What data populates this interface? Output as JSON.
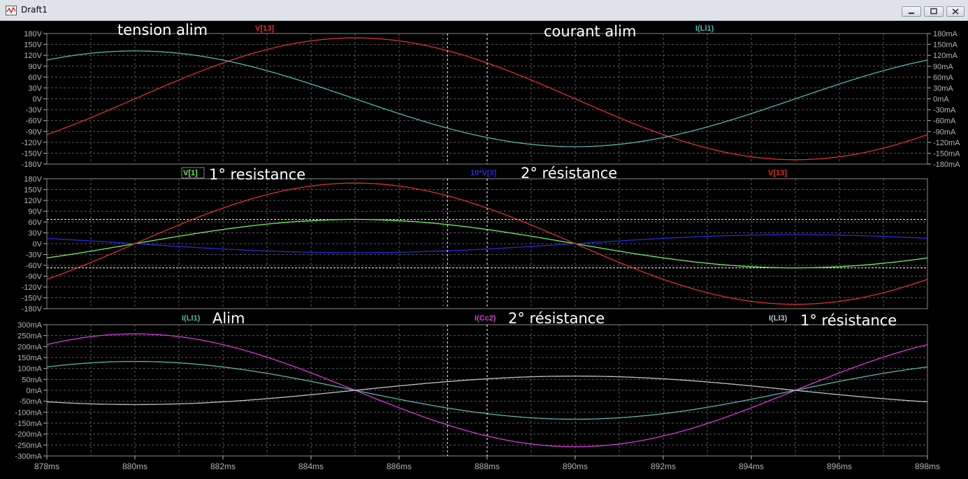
{
  "window": {
    "title": "Draft1"
  },
  "colors": {
    "background": "#000000",
    "grid": "#5a5a5a",
    "axis_text": "#b4b4b4",
    "V13": "#e0302a",
    "IL1": "#4fb7b0",
    "V1": "#6ef05a",
    "V3": "#2a2ad8",
    "ICc2": "#d63ad6",
    "IL3": "#c0c0c0",
    "cursor": "#ffffff"
  },
  "chart_data": [
    {
      "type": "line",
      "pane": 1,
      "xlim": [
        878,
        898
      ],
      "ylim": [
        -180,
        180
      ],
      "y2lim": [
        -180,
        180
      ],
      "grid": true,
      "annotations": [
        "tension alim",
        "courant alim"
      ],
      "left_ticks": [
        "180V",
        "150V",
        "120V",
        "90V",
        "60V",
        "30V",
        "0V",
        "-30V",
        "-60V",
        "-90V",
        "-120V",
        "-150V",
        "-180V"
      ],
      "right_ticks": [
        "180mA",
        "150mA",
        "120mA",
        "90mA",
        "60mA",
        "30mA",
        "0mA",
        "-30mA",
        "-60mA",
        "-90mA",
        "-120mA",
        "-150mA",
        "-180mA"
      ],
      "series": [
        {
          "name": "V[13]",
          "color": "#e0302a",
          "axis": "left",
          "amplitude": 168,
          "frequency_hz": 50,
          "phase_deg": 0
        },
        {
          "name": "I(Ll1)",
          "color": "#4fb7b0",
          "axis": "right",
          "amplitude": 132,
          "frequency_hz": 50,
          "phase_deg": 90
        }
      ]
    },
    {
      "type": "line",
      "pane": 2,
      "xlim": [
        878,
        898
      ],
      "ylim": [
        -180,
        180
      ],
      "grid": true,
      "annotations": [
        "1° resistance",
        "2° résistance"
      ],
      "left_ticks": [
        "180V",
        "150V",
        "120V",
        "90V",
        "60V",
        "30V",
        "0V",
        "-30V",
        "-60V",
        "-90V",
        "-120V",
        "-150V",
        "-180V"
      ],
      "series": [
        {
          "name": "V[1]",
          "color": "#6ef05a",
          "axis": "left",
          "amplitude": 67,
          "frequency_hz": 50,
          "phase_deg": 0
        },
        {
          "name": "10*V[3]",
          "color": "#2a2ad8",
          "axis": "left",
          "amplitude": 25,
          "frequency_hz": 50,
          "phase_deg": 180
        },
        {
          "name": "V[13]",
          "color": "#e0302a",
          "axis": "left",
          "amplitude": 168,
          "frequency_hz": 50,
          "phase_deg": 0
        }
      ],
      "hlines": [
        67,
        -67
      ]
    },
    {
      "type": "line",
      "pane": 3,
      "xlim": [
        878,
        898
      ],
      "ylim": [
        -300,
        300
      ],
      "grid": true,
      "annotations": [
        "Alim",
        "2° résistance",
        "1° résistance"
      ],
      "left_ticks": [
        "300mA",
        "250mA",
        "200mA",
        "150mA",
        "100mA",
        "50mA",
        "0mA",
        "-50mA",
        "-100mA",
        "-150mA",
        "-200mA",
        "-250mA",
        "-300mA"
      ],
      "x_ticks": [
        "878ms",
        "880ms",
        "882ms",
        "884ms",
        "886ms",
        "888ms",
        "890ms",
        "892ms",
        "894ms",
        "896ms",
        "898ms"
      ],
      "series": [
        {
          "name": "I(Ll1)",
          "color": "#4fb7b0",
          "axis": "left",
          "amplitude": 132,
          "frequency_hz": 50,
          "phase_deg": 90
        },
        {
          "name": "I(Cc2)",
          "color": "#d63ad6",
          "axis": "left",
          "amplitude": 258,
          "frequency_hz": 50,
          "phase_deg": 90
        },
        {
          "name": "I(Ll3)",
          "color": "#c0c0c0",
          "axis": "left",
          "amplitude": 65,
          "frequency_hz": 50,
          "phase_deg": -90
        }
      ]
    }
  ],
  "cursors_ms": [
    887.1,
    888.0
  ]
}
